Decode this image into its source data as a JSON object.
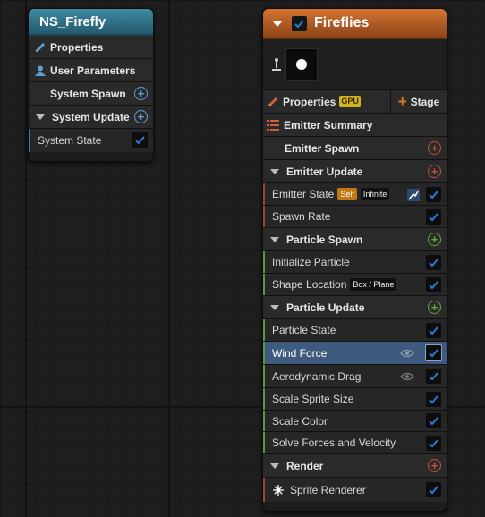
{
  "system_node": {
    "title": "NS_Firefly",
    "rows": {
      "properties": "Properties",
      "user_parameters": "User Parameters",
      "system_spawn": "System Spawn",
      "system_update": "System Update",
      "system_state": "System State"
    }
  },
  "emitter_node": {
    "title": "Fireflies",
    "enabled": true,
    "properties": "Properties",
    "gpu_badge": "GPU",
    "stage_button": "Stage",
    "emitter_summary": "Emitter Summary",
    "emitter_spawn": "Emitter Spawn",
    "emitter_update": "Emitter Update",
    "emitter_state": "Emitter State",
    "self_badge": "Self",
    "infinite_badge": "Infinite",
    "spawn_rate": "Spawn Rate",
    "particle_spawn": "Particle Spawn",
    "initialize_particle": "Initialize Particle",
    "shape_location": "Shape Location",
    "box_plane_badge": "Box / Plane",
    "particle_update": "Particle Update",
    "particle_state": "Particle State",
    "wind_force": "Wind Force",
    "aerodynamic_drag": "Aerodynamic Drag",
    "scale_sprite_size": "Scale Sprite Size",
    "scale_color": "Scale Color",
    "solve_forces": "Solve Forces and Velocity",
    "render": "Render",
    "sprite_renderer": "Sprite Renderer"
  },
  "colors": {
    "system_header": "#2e7189",
    "emitter_header": "#b8602a",
    "selection": "#3e5a7e",
    "checkbox_blue": "#2f7ad6"
  }
}
